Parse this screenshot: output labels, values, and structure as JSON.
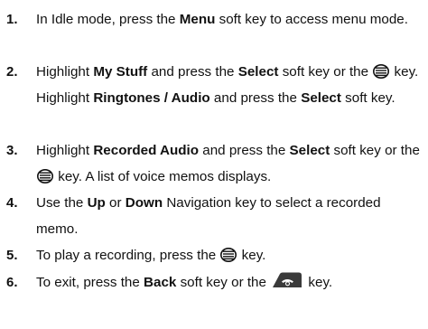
{
  "steps": [
    {
      "num": "1.",
      "parts": [
        {
          "t": "text",
          "v": "In Idle mode, press the "
        },
        {
          "t": "bold",
          "v": "Menu"
        },
        {
          "t": "text",
          "v": " soft key to access menu mode."
        }
      ]
    },
    {
      "num": "2.",
      "parts": [
        {
          "t": "text",
          "v": "Highlight "
        },
        {
          "t": "bold",
          "v": "My Stuff"
        },
        {
          "t": "text",
          "v": " and press the "
        },
        {
          "t": "bold",
          "v": "Select"
        },
        {
          "t": "text",
          "v": " soft key or the "
        },
        {
          "t": "icon",
          "v": "select-key-icon"
        },
        {
          "t": "text",
          "v": " key. Highlight "
        },
        {
          "t": "bold",
          "v": "Ringtones / Audio"
        },
        {
          "t": "text",
          "v": " and press the "
        },
        {
          "t": "bold",
          "v": "Select"
        },
        {
          "t": "text",
          "v": " soft key."
        }
      ]
    },
    {
      "num": "3.",
      "parts": [
        {
          "t": "text",
          "v": "Highlight "
        },
        {
          "t": "bold",
          "v": "Recorded Audio"
        },
        {
          "t": "text",
          "v": " and press the "
        },
        {
          "t": "bold",
          "v": "Select"
        },
        {
          "t": "text",
          "v": " soft key or the "
        },
        {
          "t": "icon",
          "v": "select-key-icon"
        },
        {
          "t": "text",
          "v": " key. A list of voice memos displays."
        }
      ]
    },
    {
      "num": "4.",
      "parts": [
        {
          "t": "text",
          "v": "Use the "
        },
        {
          "t": "bold",
          "v": "Up"
        },
        {
          "t": "text",
          "v": " or "
        },
        {
          "t": "bold",
          "v": "Down"
        },
        {
          "t": "text",
          "v": " Navigation key to select a recorded memo."
        }
      ]
    },
    {
      "num": "5.",
      "parts": [
        {
          "t": "text",
          "v": "To play a recording, press the "
        },
        {
          "t": "icon",
          "v": "select-key-icon"
        },
        {
          "t": "text",
          "v": " key."
        }
      ]
    },
    {
      "num": "6.",
      "parts": [
        {
          "t": "text",
          "v": "To exit, press the "
        },
        {
          "t": "bold",
          "v": "Back"
        },
        {
          "t": "text",
          "v": " soft key or the "
        },
        {
          "t": "icon",
          "v": "end-key-icon"
        },
        {
          "t": "text",
          "v": " key."
        }
      ]
    }
  ]
}
